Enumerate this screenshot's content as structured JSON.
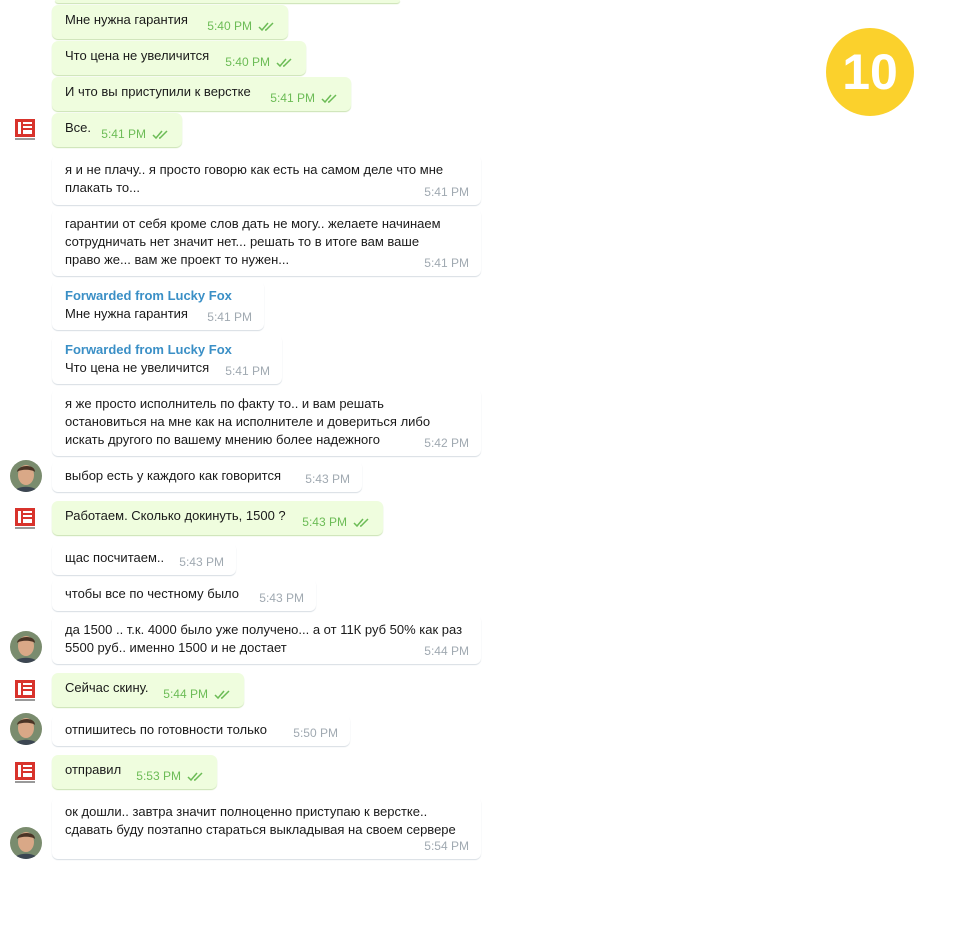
{
  "badge": "10",
  "messages": [
    {
      "dir": "out",
      "text": "Мне нужна гарантия",
      "time": "5:40 PM"
    },
    {
      "dir": "out",
      "text": "Что цена не увеличится",
      "time": "5:40 PM"
    },
    {
      "dir": "out",
      "text": "И что вы приступили к верстке",
      "time": "5:41 PM"
    },
    {
      "dir": "out",
      "text": "Все.",
      "time": "5:41 PM"
    },
    {
      "dir": "in",
      "text": "я и не плачу.. я просто говорю как есть на самом деле что мне\nплакать то...",
      "time": "5:41 PM"
    },
    {
      "dir": "in",
      "text": "гарантии от себя кроме слов дать не могу.. желаете начинаем\nсотрудничать нет значит нет... решать то в итоге вам ваше\nправо же... вам же проект то нужен...",
      "time": "5:41 PM"
    },
    {
      "dir": "in",
      "forward": "Forwarded from Lucky Fox",
      "text": "Мне нужна гарантия",
      "time": "5:41 PM"
    },
    {
      "dir": "in",
      "forward": "Forwarded from Lucky Fox",
      "text": "Что цена не увеличится",
      "time": "5:41 PM"
    },
    {
      "dir": "in",
      "text": "я же просто исполнитель по факту то.. и вам решать\nостановиться на мне как на исполнителе и довериться либо\nискать другого по вашему мнению более надежного",
      "time": "5:42 PM"
    },
    {
      "dir": "in",
      "text": "выбор есть у каждого как говорится",
      "time": "5:43 PM"
    },
    {
      "dir": "out",
      "text": "Работаем. Сколько докинуть, 1500 ?",
      "time": "5:43 PM"
    },
    {
      "dir": "in",
      "text": "щас посчитаем..",
      "time": "5:43 PM"
    },
    {
      "dir": "in",
      "text": "чтобы все по честному было",
      "time": "5:43 PM"
    },
    {
      "dir": "in",
      "text": "да 1500 .. т.к. 4000 было уже получено... а от 11К руб 50% как раз\n5500 руб.. именно 1500 и не достает",
      "time": "5:44 PM"
    },
    {
      "dir": "out",
      "text": "Сейчас скину.",
      "time": "5:44 PM"
    },
    {
      "dir": "in",
      "text": "отпишитесь по готовности только",
      "time": "5:50 PM"
    },
    {
      "dir": "out",
      "text": "отправил",
      "time": "5:53 PM"
    },
    {
      "dir": "in",
      "text": "ок дошли.. завтра значит полноценно приступаю к верстке..\nсдавать буду поэтапно стараться выкладывая на своем сервере",
      "time": "5:54 PM"
    }
  ]
}
